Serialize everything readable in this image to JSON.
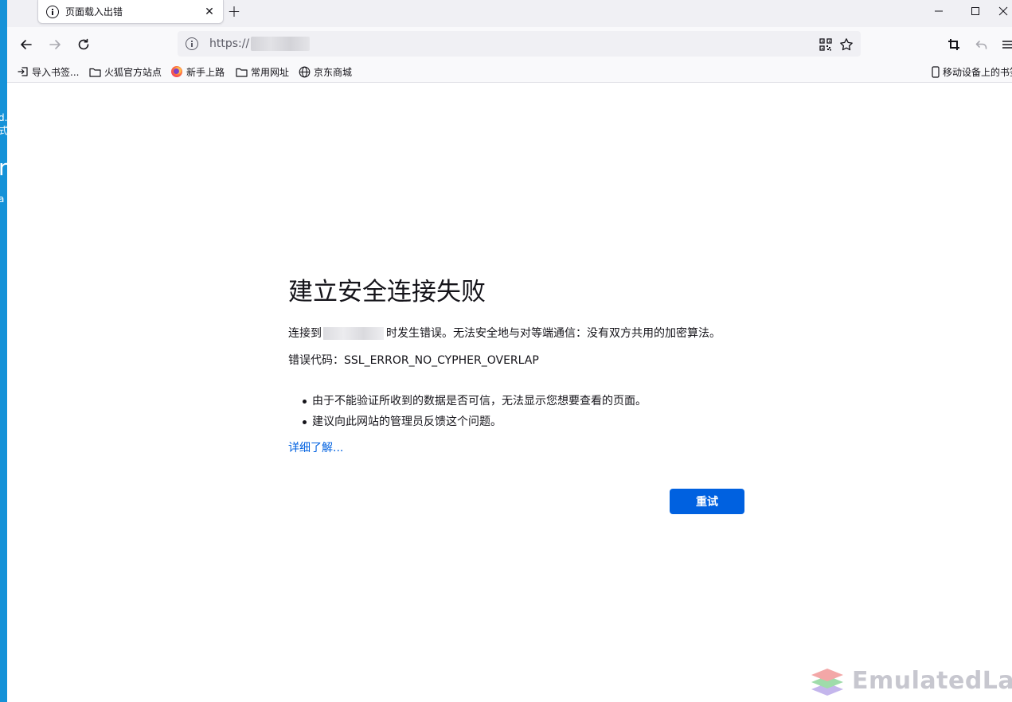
{
  "tab": {
    "title": "页面载入出错",
    "close": "✕"
  },
  "newtab": "+",
  "window_controls": {
    "minimize": "—",
    "maximize": "☐",
    "close": "✕"
  },
  "url": {
    "prefix": "https://"
  },
  "bookmarks": [
    {
      "label": "导入书签...",
      "icon": "import-icon"
    },
    {
      "label": "火狐官方站点",
      "icon": "folder-icon"
    },
    {
      "label": "新手上路",
      "icon": "firefox-icon"
    },
    {
      "label": "常用网址",
      "icon": "folder-icon"
    },
    {
      "label": "京东商城",
      "icon": "globe-icon"
    }
  ],
  "mobile_bookmarks": "移动设备上的书签",
  "error": {
    "title": "建立安全连接失败",
    "desc_before": "连接到",
    "desc_after": "时发生错误。无法安全地与对等端通信：没有双方共用的加密算法。",
    "code_label": "错误代码：",
    "code": "SSL_ERROR_NO_CYPHER_OVERLAP",
    "bullets": [
      "由于不能验证所收到的数据是否可信，无法显示您想要查看的页面。",
      "建议向此网站的管理员反馈这个问题。"
    ],
    "learn_more": "详细了解...",
    "retry": "重试"
  },
  "desktop_fragments": [
    "d..",
    "式",
    "n",
    "a"
  ],
  "watermark": "EmulatedLab",
  "colors": {
    "accent": "#0061e0",
    "desktop": "#1592d8"
  }
}
